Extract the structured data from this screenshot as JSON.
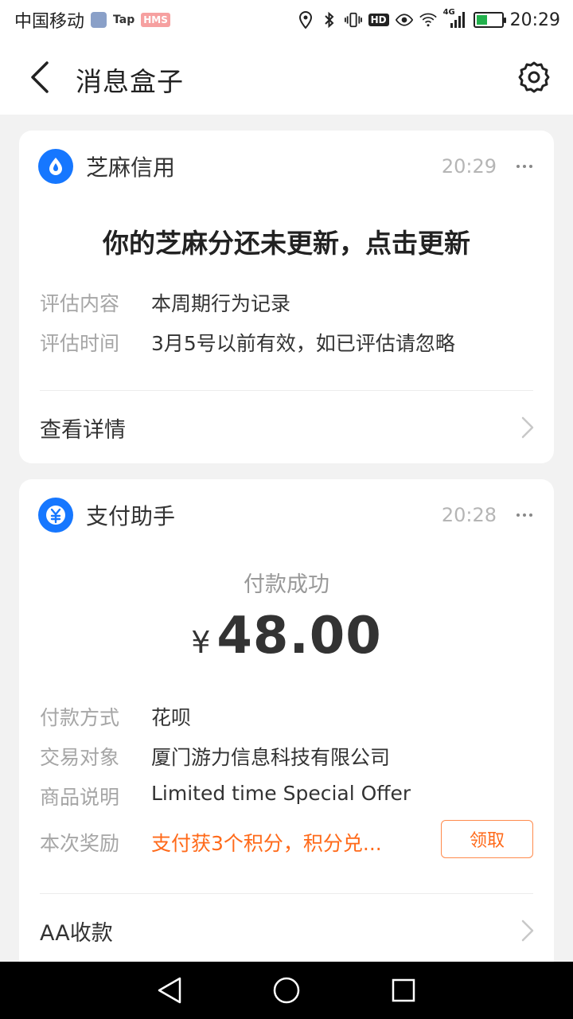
{
  "status_bar": {
    "carrier": "中国移动",
    "tap_badge": "Tap",
    "hms_badge": "HMS",
    "hd_badge": "HD",
    "network_badge": "4G",
    "time": "20:29"
  },
  "header": {
    "title": "消息盒子"
  },
  "cards": [
    {
      "app_name": "芝麻信用",
      "time": "20:29",
      "headline": "你的芝麻分还未更新，点击更新",
      "rows": [
        {
          "label": "评估内容",
          "value": "本周期行为记录"
        },
        {
          "label": "评估时间",
          "value": "3月5号以前有效，如已评估请忽略"
        }
      ],
      "link_label": "查看详情"
    },
    {
      "app_name": "支付助手",
      "time": "20:28",
      "status": "付款成功",
      "currency": "¥",
      "amount": "48.00",
      "rows": [
        {
          "label": "付款方式",
          "value": "花呗"
        },
        {
          "label": "交易对象",
          "value": "厦门游力信息科技有限公司"
        },
        {
          "label": "商品说明",
          "value": "Limited time Special Offer"
        },
        {
          "label": "本次奖励",
          "value": "支付获3个积分，积分兑..."
        }
      ],
      "claim_button": "领取",
      "link_label": "AA收款"
    }
  ],
  "colors": {
    "accent_blue": "#1677ff",
    "reward_orange": "#ff6a1a",
    "background": "#f2f2f2"
  }
}
